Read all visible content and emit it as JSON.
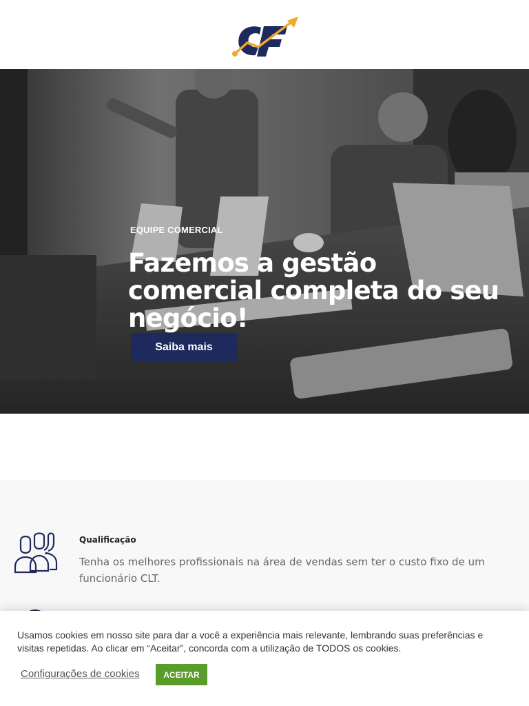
{
  "header": {
    "logo_text": "CF",
    "logo_icon": "growth-arrow-icon",
    "colors": {
      "navy": "#1f2a5c",
      "gold": "#f0a92d"
    }
  },
  "hero": {
    "eyebrow": "EQUIPE COMERCIAL",
    "title": "Fazemos a gestão comercial completa do seu negócio!",
    "button_label": "Saiba mais",
    "button_color": "#1f2a5c"
  },
  "features": {
    "items": [
      {
        "icon": "users-icon",
        "title": "Qualificação",
        "text": "Tenha os melhores profissionais na área de vendas sem ter o custo fixo de um funcionário CLT."
      }
    ]
  },
  "cookie_bar": {
    "message": "Usamos cookies em nosso site para dar a você a experiência mais relevante, lembrando suas preferências e visitas repetidas. Ao clicar em “Aceitar”, concorda com a utilização de TODOS os cookies.",
    "settings_label": "Configurações de cookies",
    "accept_label": "ACEITAR",
    "accept_color": "#5a9c2a"
  }
}
